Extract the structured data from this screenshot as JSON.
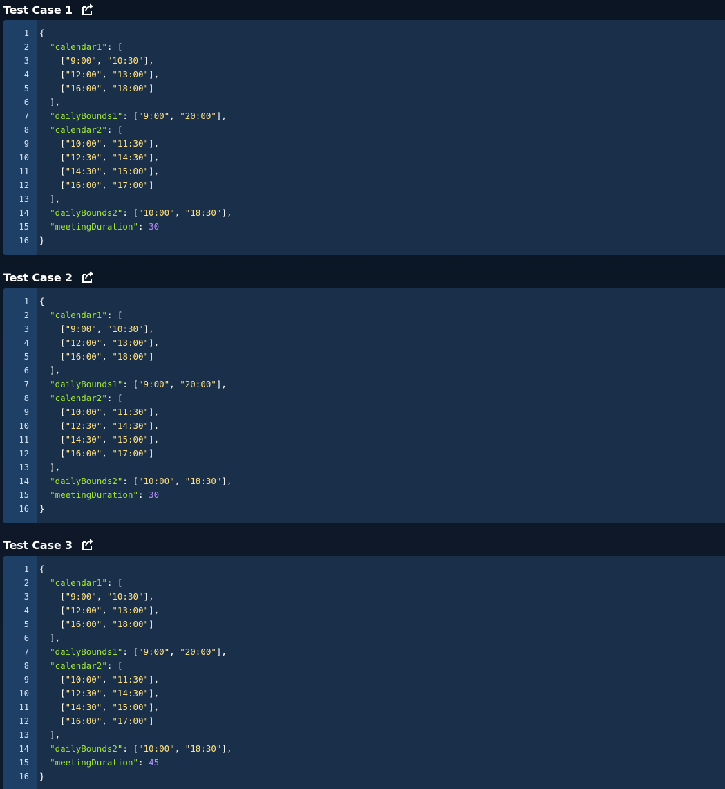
{
  "test_cases": [
    {
      "title": "Test Case 1",
      "share_icon": "share-icon",
      "lines": [
        [
          {
            "t": "p",
            "v": "{"
          }
        ],
        [
          {
            "t": "p",
            "v": "  "
          },
          {
            "t": "key",
            "v": "\"calendar1\""
          },
          {
            "t": "p",
            "v": ": ["
          }
        ],
        [
          {
            "t": "p",
            "v": "    ["
          },
          {
            "t": "str",
            "v": "\"9:00\""
          },
          {
            "t": "p",
            "v": ", "
          },
          {
            "t": "str",
            "v": "\"10:30\""
          },
          {
            "t": "p",
            "v": "],"
          }
        ],
        [
          {
            "t": "p",
            "v": "    ["
          },
          {
            "t": "str",
            "v": "\"12:00\""
          },
          {
            "t": "p",
            "v": ", "
          },
          {
            "t": "str",
            "v": "\"13:00\""
          },
          {
            "t": "p",
            "v": "],"
          }
        ],
        [
          {
            "t": "p",
            "v": "    ["
          },
          {
            "t": "str",
            "v": "\"16:00\""
          },
          {
            "t": "p",
            "v": ", "
          },
          {
            "t": "str",
            "v": "\"18:00\""
          },
          {
            "t": "p",
            "v": "]"
          }
        ],
        [
          {
            "t": "p",
            "v": "  ],"
          }
        ],
        [
          {
            "t": "p",
            "v": "  "
          },
          {
            "t": "key",
            "v": "\"dailyBounds1\""
          },
          {
            "t": "p",
            "v": ": ["
          },
          {
            "t": "str",
            "v": "\"9:00\""
          },
          {
            "t": "p",
            "v": ", "
          },
          {
            "t": "str",
            "v": "\"20:00\""
          },
          {
            "t": "p",
            "v": "],"
          }
        ],
        [
          {
            "t": "p",
            "v": "  "
          },
          {
            "t": "key",
            "v": "\"calendar2\""
          },
          {
            "t": "p",
            "v": ": ["
          }
        ],
        [
          {
            "t": "p",
            "v": "    ["
          },
          {
            "t": "str",
            "v": "\"10:00\""
          },
          {
            "t": "p",
            "v": ", "
          },
          {
            "t": "str",
            "v": "\"11:30\""
          },
          {
            "t": "p",
            "v": "],"
          }
        ],
        [
          {
            "t": "p",
            "v": "    ["
          },
          {
            "t": "str",
            "v": "\"12:30\""
          },
          {
            "t": "p",
            "v": ", "
          },
          {
            "t": "str",
            "v": "\"14:30\""
          },
          {
            "t": "p",
            "v": "],"
          }
        ],
        [
          {
            "t": "p",
            "v": "    ["
          },
          {
            "t": "str",
            "v": "\"14:30\""
          },
          {
            "t": "p",
            "v": ", "
          },
          {
            "t": "str",
            "v": "\"15:00\""
          },
          {
            "t": "p",
            "v": "],"
          }
        ],
        [
          {
            "t": "p",
            "v": "    ["
          },
          {
            "t": "str",
            "v": "\"16:00\""
          },
          {
            "t": "p",
            "v": ", "
          },
          {
            "t": "str",
            "v": "\"17:00\""
          },
          {
            "t": "p",
            "v": "]"
          }
        ],
        [
          {
            "t": "p",
            "v": "  ],"
          }
        ],
        [
          {
            "t": "p",
            "v": "  "
          },
          {
            "t": "key",
            "v": "\"dailyBounds2\""
          },
          {
            "t": "p",
            "v": ": ["
          },
          {
            "t": "str",
            "v": "\"10:00\""
          },
          {
            "t": "p",
            "v": ", "
          },
          {
            "t": "str",
            "v": "\"18:30\""
          },
          {
            "t": "p",
            "v": "],"
          }
        ],
        [
          {
            "t": "p",
            "v": "  "
          },
          {
            "t": "key",
            "v": "\"meetingDuration\""
          },
          {
            "t": "p",
            "v": ": "
          },
          {
            "t": "num",
            "v": "30"
          }
        ],
        [
          {
            "t": "p",
            "v": "}"
          }
        ]
      ]
    },
    {
      "title": "Test Case 2",
      "share_icon": "share-icon",
      "lines": [
        [
          {
            "t": "p",
            "v": "{"
          }
        ],
        [
          {
            "t": "p",
            "v": "  "
          },
          {
            "t": "key",
            "v": "\"calendar1\""
          },
          {
            "t": "p",
            "v": ": ["
          }
        ],
        [
          {
            "t": "p",
            "v": "    ["
          },
          {
            "t": "str",
            "v": "\"9:00\""
          },
          {
            "t": "p",
            "v": ", "
          },
          {
            "t": "str",
            "v": "\"10:30\""
          },
          {
            "t": "p",
            "v": "],"
          }
        ],
        [
          {
            "t": "p",
            "v": "    ["
          },
          {
            "t": "str",
            "v": "\"12:00\""
          },
          {
            "t": "p",
            "v": ", "
          },
          {
            "t": "str",
            "v": "\"13:00\""
          },
          {
            "t": "p",
            "v": "],"
          }
        ],
        [
          {
            "t": "p",
            "v": "    ["
          },
          {
            "t": "str",
            "v": "\"16:00\""
          },
          {
            "t": "p",
            "v": ", "
          },
          {
            "t": "str",
            "v": "\"18:00\""
          },
          {
            "t": "p",
            "v": "]"
          }
        ],
        [
          {
            "t": "p",
            "v": "  ],"
          }
        ],
        [
          {
            "t": "p",
            "v": "  "
          },
          {
            "t": "key",
            "v": "\"dailyBounds1\""
          },
          {
            "t": "p",
            "v": ": ["
          },
          {
            "t": "str",
            "v": "\"9:00\""
          },
          {
            "t": "p",
            "v": ", "
          },
          {
            "t": "str",
            "v": "\"20:00\""
          },
          {
            "t": "p",
            "v": "],"
          }
        ],
        [
          {
            "t": "p",
            "v": "  "
          },
          {
            "t": "key",
            "v": "\"calendar2\""
          },
          {
            "t": "p",
            "v": ": ["
          }
        ],
        [
          {
            "t": "p",
            "v": "    ["
          },
          {
            "t": "str",
            "v": "\"10:00\""
          },
          {
            "t": "p",
            "v": ", "
          },
          {
            "t": "str",
            "v": "\"11:30\""
          },
          {
            "t": "p",
            "v": "],"
          }
        ],
        [
          {
            "t": "p",
            "v": "    ["
          },
          {
            "t": "str",
            "v": "\"12:30\""
          },
          {
            "t": "p",
            "v": ", "
          },
          {
            "t": "str",
            "v": "\"14:30\""
          },
          {
            "t": "p",
            "v": "],"
          }
        ],
        [
          {
            "t": "p",
            "v": "    ["
          },
          {
            "t": "str",
            "v": "\"14:30\""
          },
          {
            "t": "p",
            "v": ", "
          },
          {
            "t": "str",
            "v": "\"15:00\""
          },
          {
            "t": "p",
            "v": "],"
          }
        ],
        [
          {
            "t": "p",
            "v": "    ["
          },
          {
            "t": "str",
            "v": "\"16:00\""
          },
          {
            "t": "p",
            "v": ", "
          },
          {
            "t": "str",
            "v": "\"17:00\""
          },
          {
            "t": "p",
            "v": "]"
          }
        ],
        [
          {
            "t": "p",
            "v": "  ],"
          }
        ],
        [
          {
            "t": "p",
            "v": "  "
          },
          {
            "t": "key",
            "v": "\"dailyBounds2\""
          },
          {
            "t": "p",
            "v": ": ["
          },
          {
            "t": "str",
            "v": "\"10:00\""
          },
          {
            "t": "p",
            "v": ", "
          },
          {
            "t": "str",
            "v": "\"18:30\""
          },
          {
            "t": "p",
            "v": "],"
          }
        ],
        [
          {
            "t": "p",
            "v": "  "
          },
          {
            "t": "key",
            "v": "\"meetingDuration\""
          },
          {
            "t": "p",
            "v": ": "
          },
          {
            "t": "num",
            "v": "30"
          }
        ],
        [
          {
            "t": "p",
            "v": "}"
          }
        ]
      ]
    },
    {
      "title": "Test Case 3",
      "share_icon": "share-icon",
      "lines": [
        [
          {
            "t": "p",
            "v": "{"
          }
        ],
        [
          {
            "t": "p",
            "v": "  "
          },
          {
            "t": "key",
            "v": "\"calendar1\""
          },
          {
            "t": "p",
            "v": ": ["
          }
        ],
        [
          {
            "t": "p",
            "v": "    ["
          },
          {
            "t": "str",
            "v": "\"9:00\""
          },
          {
            "t": "p",
            "v": ", "
          },
          {
            "t": "str",
            "v": "\"10:30\""
          },
          {
            "t": "p",
            "v": "],"
          }
        ],
        [
          {
            "t": "p",
            "v": "    ["
          },
          {
            "t": "str",
            "v": "\"12:00\""
          },
          {
            "t": "p",
            "v": ", "
          },
          {
            "t": "str",
            "v": "\"13:00\""
          },
          {
            "t": "p",
            "v": "],"
          }
        ],
        [
          {
            "t": "p",
            "v": "    ["
          },
          {
            "t": "str",
            "v": "\"16:00\""
          },
          {
            "t": "p",
            "v": ", "
          },
          {
            "t": "str",
            "v": "\"18:00\""
          },
          {
            "t": "p",
            "v": "]"
          }
        ],
        [
          {
            "t": "p",
            "v": "  ],"
          }
        ],
        [
          {
            "t": "p",
            "v": "  "
          },
          {
            "t": "key",
            "v": "\"dailyBounds1\""
          },
          {
            "t": "p",
            "v": ": ["
          },
          {
            "t": "str",
            "v": "\"9:00\""
          },
          {
            "t": "p",
            "v": ", "
          },
          {
            "t": "str",
            "v": "\"20:00\""
          },
          {
            "t": "p",
            "v": "],"
          }
        ],
        [
          {
            "t": "p",
            "v": "  "
          },
          {
            "t": "key",
            "v": "\"calendar2\""
          },
          {
            "t": "p",
            "v": ": ["
          }
        ],
        [
          {
            "t": "p",
            "v": "    ["
          },
          {
            "t": "str",
            "v": "\"10:00\""
          },
          {
            "t": "p",
            "v": ", "
          },
          {
            "t": "str",
            "v": "\"11:30\""
          },
          {
            "t": "p",
            "v": "],"
          }
        ],
        [
          {
            "t": "p",
            "v": "    ["
          },
          {
            "t": "str",
            "v": "\"12:30\""
          },
          {
            "t": "p",
            "v": ", "
          },
          {
            "t": "str",
            "v": "\"14:30\""
          },
          {
            "t": "p",
            "v": "],"
          }
        ],
        [
          {
            "t": "p",
            "v": "    ["
          },
          {
            "t": "str",
            "v": "\"14:30\""
          },
          {
            "t": "p",
            "v": ", "
          },
          {
            "t": "str",
            "v": "\"15:00\""
          },
          {
            "t": "p",
            "v": "],"
          }
        ],
        [
          {
            "t": "p",
            "v": "    ["
          },
          {
            "t": "str",
            "v": "\"16:00\""
          },
          {
            "t": "p",
            "v": ", "
          },
          {
            "t": "str",
            "v": "\"17:00\""
          },
          {
            "t": "p",
            "v": "]"
          }
        ],
        [
          {
            "t": "p",
            "v": "  ],"
          }
        ],
        [
          {
            "t": "p",
            "v": "  "
          },
          {
            "t": "key",
            "v": "\"dailyBounds2\""
          },
          {
            "t": "p",
            "v": ": ["
          },
          {
            "t": "str",
            "v": "\"10:00\""
          },
          {
            "t": "p",
            "v": ", "
          },
          {
            "t": "str",
            "v": "\"18:30\""
          },
          {
            "t": "p",
            "v": "],"
          }
        ],
        [
          {
            "t": "p",
            "v": "  "
          },
          {
            "t": "key",
            "v": "\"meetingDuration\""
          },
          {
            "t": "p",
            "v": ": "
          },
          {
            "t": "num",
            "v": "45"
          }
        ],
        [
          {
            "t": "p",
            "v": "}"
          }
        ]
      ]
    }
  ],
  "colors": {
    "background": "#0f1a2a",
    "editor": "#1a2f49",
    "gutter": "#1f4066",
    "key": "#9ee62e",
    "string": "#ffe081",
    "number": "#b58cff"
  }
}
